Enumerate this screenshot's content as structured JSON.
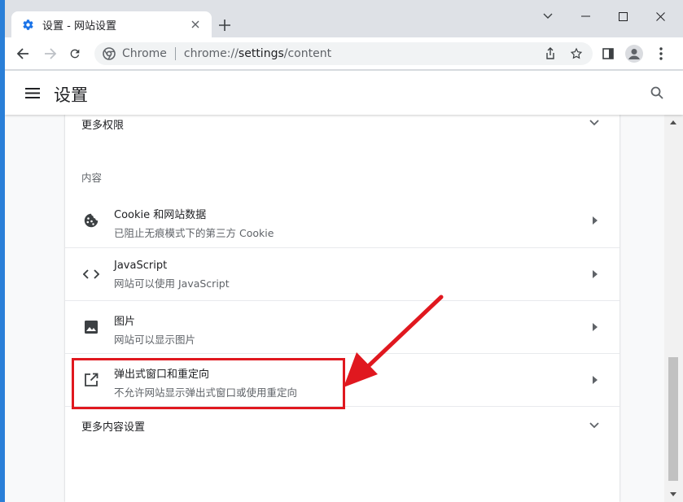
{
  "browser": {
    "tab": {
      "title": "设置 - 网站设置",
      "icon": "gear-icon"
    },
    "omnibox": {
      "chip": "Chrome",
      "url_prefix": "chrome://",
      "url_host": "settings",
      "url_path": "/content"
    }
  },
  "settings": {
    "title": "设置",
    "more_permissions": "更多权限",
    "section_label": "内容",
    "items": [
      {
        "title": "Cookie 和网站数据",
        "subtitle": "已阻止无痕模式下的第三方 Cookie",
        "icon": "cookie-icon"
      },
      {
        "title": "JavaScript",
        "subtitle": "网站可以使用 JavaScript",
        "icon": "code-icon"
      },
      {
        "title": "图片",
        "subtitle": "网站可以显示图片",
        "icon": "image-icon"
      },
      {
        "title": "弹出式窗口和重定向",
        "subtitle": "不允许网站显示弹出式窗口或使用重定向",
        "icon": "open-in-new-icon"
      }
    ],
    "more_content": "更多内容设置"
  },
  "colors": {
    "accent": "#1a73e8",
    "annotation": "#e0181f",
    "desktop": "#2a7fd8"
  }
}
